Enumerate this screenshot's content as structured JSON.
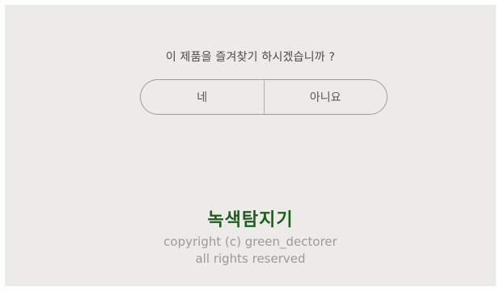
{
  "dialog": {
    "question": "이 제품을 즐겨찾기 하시겠습니까 ?",
    "yes_label": "네",
    "no_label": "아니요"
  },
  "footer": {
    "brand": "녹색탐지기",
    "copyright_line1": "copyright (c) green_dectorer",
    "copyright_line2": "all rights reserved"
  },
  "colors": {
    "background": "#ecebe8",
    "brand": "#1d5d1d",
    "text": "#4a4a4a",
    "muted": "#9a9a9a"
  }
}
